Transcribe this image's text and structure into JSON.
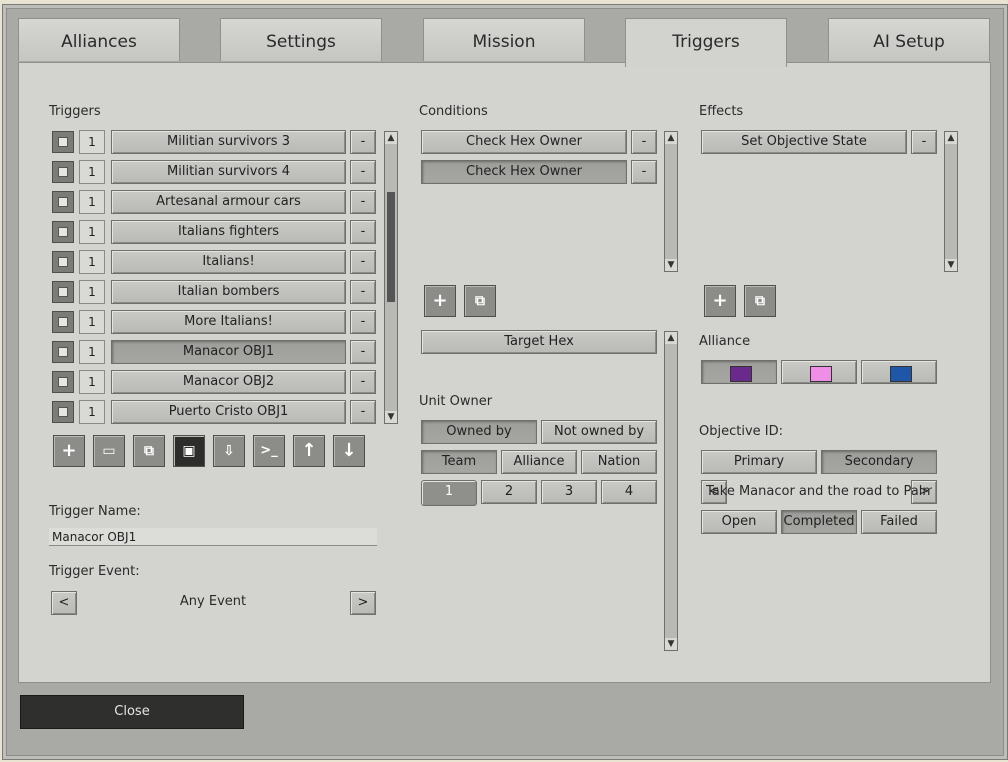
{
  "tabs": [
    {
      "label": "Alliances"
    },
    {
      "label": "Settings"
    },
    {
      "label": "Mission"
    },
    {
      "label": "Triggers"
    },
    {
      "label": "AI Setup"
    }
  ],
  "triggers": {
    "heading": "Triggers",
    "rows": [
      {
        "num": "1",
        "label": "Militian survivors 3",
        "remove": "-"
      },
      {
        "num": "1",
        "label": "Militian survivors 4",
        "remove": "-"
      },
      {
        "num": "1",
        "label": "Artesanal armour cars",
        "remove": "-"
      },
      {
        "num": "1",
        "label": "Italians fighters",
        "remove": "-"
      },
      {
        "num": "1",
        "label": "Italians!",
        "remove": "-"
      },
      {
        "num": "1",
        "label": "Italian bombers",
        "remove": "-"
      },
      {
        "num": "1",
        "label": "More Italians!",
        "remove": "-"
      },
      {
        "num": "1",
        "label": "Manacor OBJ1",
        "remove": "-"
      },
      {
        "num": "1",
        "label": "Manacor OBJ2",
        "remove": "-"
      },
      {
        "num": "1",
        "label": "Puerto Cristo OBJ1",
        "remove": "-"
      }
    ],
    "toolbar_icons": [
      "plus-icon",
      "folder-icon",
      "copy-icon",
      "save-icon",
      "import-icon",
      "console-icon",
      "arrow-up-icon",
      "arrow-down-icon"
    ],
    "name_label": "Trigger Name:",
    "name_value": "Manacor OBJ1",
    "event_label": "Trigger Event:",
    "event_prev": "<",
    "event_value": "Any Event",
    "event_next": ">"
  },
  "conditions": {
    "heading": "Conditions",
    "rows": [
      {
        "label": "Check Hex Owner",
        "remove": "-"
      },
      {
        "label": "Check Hex Owner",
        "remove": "-"
      }
    ],
    "target_hex": "Target Hex",
    "unit_owner_label": "Unit Owner",
    "owned_by": "Owned by",
    "not_owned_by": "Not owned by",
    "team": "Team",
    "alliance": "Alliance",
    "nation": "Nation",
    "numbers": [
      "1",
      "2",
      "3",
      "4"
    ]
  },
  "effects": {
    "heading": "Effects",
    "rows": [
      {
        "label": "Set Objective State",
        "remove": "-"
      }
    ],
    "alliance_label": "Alliance",
    "alliance_colors": [
      "#6a2a8c",
      "#ee8ee6",
      "#2056a8"
    ],
    "objective_label": "Objective ID:",
    "primary": "Primary",
    "secondary": "Secondary",
    "objective_text": "Take Manacor and the road to Palma",
    "objective_prev": "<",
    "objective_next": ">",
    "open": "Open",
    "completed": "Completed",
    "failed": "Failed"
  },
  "footer": {
    "close": "Close"
  }
}
